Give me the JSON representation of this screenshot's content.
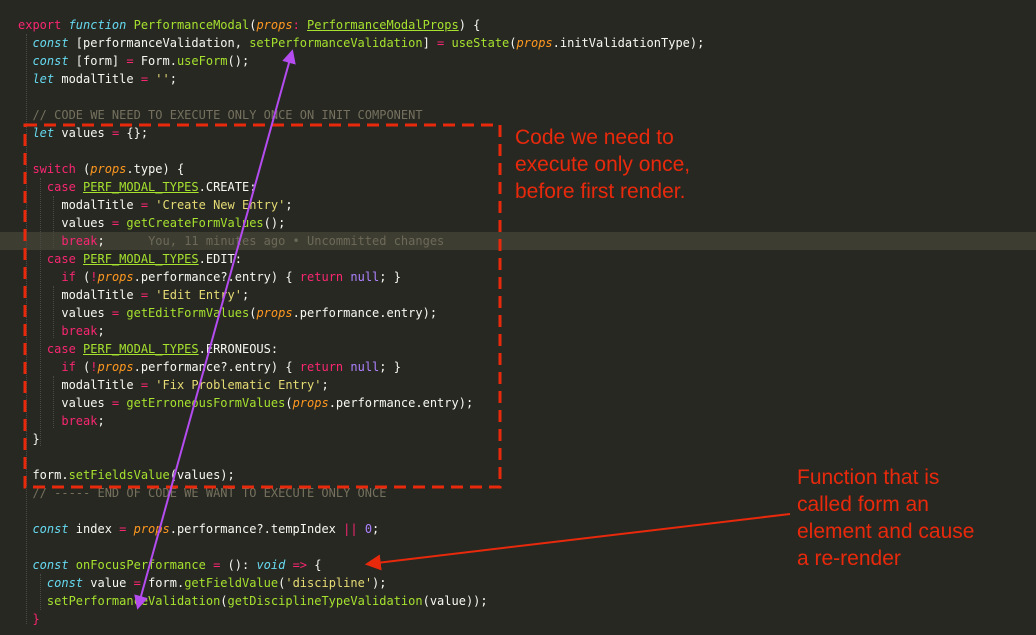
{
  "editor": {
    "lines": [
      {
        "tokens": [
          {
            "t": "export ",
            "c": "kw"
          },
          {
            "t": "function ",
            "c": "it"
          },
          {
            "t": "PerformanceModal",
            "c": "fn"
          },
          {
            "t": "(",
            "c": "bl"
          },
          {
            "t": "props",
            "c": "pr"
          },
          {
            "t": ": ",
            "c": "kw"
          },
          {
            "t": "PerformanceModalProps",
            "c": "ty"
          },
          {
            "t": ") {",
            "c": "bl"
          }
        ]
      },
      {
        "tokens": [
          {
            "t": "  const ",
            "c": "it"
          },
          {
            "t": "[performanceValidation, ",
            "c": "bl"
          },
          {
            "t": "setPerformanceValidation",
            "c": "fn"
          },
          {
            "t": "] ",
            "c": "bl"
          },
          {
            "t": "= ",
            "c": "op"
          },
          {
            "t": "useState",
            "c": "fn"
          },
          {
            "t": "(",
            "c": "bl"
          },
          {
            "t": "props",
            "c": "pr"
          },
          {
            "t": ".initValidationType);",
            "c": "bl"
          }
        ]
      },
      {
        "tokens": [
          {
            "t": "  const ",
            "c": "it"
          },
          {
            "t": "[form] ",
            "c": "bl"
          },
          {
            "t": "= ",
            "c": "op"
          },
          {
            "t": "Form.",
            "c": "bl"
          },
          {
            "t": "useForm",
            "c": "fn"
          },
          {
            "t": "();",
            "c": "bl"
          }
        ]
      },
      {
        "tokens": [
          {
            "t": "  let ",
            "c": "it"
          },
          {
            "t": "modalTitle ",
            "c": "bl"
          },
          {
            "t": "= ",
            "c": "op"
          },
          {
            "t": "''",
            "c": "st"
          },
          {
            "t": ";",
            "c": "bl"
          }
        ]
      },
      {
        "tokens": []
      },
      {
        "tokens": [
          {
            "t": "  // CODE WE NEED TO EXECUTE ONLY ONCE ON INIT COMPONENT",
            "c": "co"
          }
        ]
      },
      {
        "tokens": [
          {
            "t": "  let ",
            "c": "it"
          },
          {
            "t": "values ",
            "c": "bl"
          },
          {
            "t": "= ",
            "c": "op"
          },
          {
            "t": "{};",
            "c": "bl"
          }
        ]
      },
      {
        "tokens": []
      },
      {
        "tokens": [
          {
            "t": "  switch ",
            "c": "kw"
          },
          {
            "t": "(",
            "c": "bl"
          },
          {
            "t": "props",
            "c": "pr"
          },
          {
            "t": ".type) {",
            "c": "bl"
          }
        ]
      },
      {
        "tokens": [
          {
            "t": "    case ",
            "c": "kw"
          },
          {
            "t": "PERF_MODAL_TYPES",
            "c": "ty"
          },
          {
            "t": ".CREATE:",
            "c": "bl"
          }
        ]
      },
      {
        "tokens": [
          {
            "t": "      modalTitle ",
            "c": "bl"
          },
          {
            "t": "= ",
            "c": "op"
          },
          {
            "t": "'Create New Entry'",
            "c": "st"
          },
          {
            "t": ";",
            "c": "bl"
          }
        ]
      },
      {
        "tokens": [
          {
            "t": "      values ",
            "c": "bl"
          },
          {
            "t": "= ",
            "c": "op"
          },
          {
            "t": "getCreateFormValues",
            "c": "fn"
          },
          {
            "t": "();",
            "c": "bl"
          }
        ]
      },
      {
        "hl": true,
        "tokens": [
          {
            "t": "      break",
            "c": "kw"
          },
          {
            "t": ";",
            "c": "bl"
          },
          {
            "t": "      You, 11 minutes ago • Uncommitted changes",
            "c": "gh"
          }
        ]
      },
      {
        "tokens": [
          {
            "t": "    case ",
            "c": "kw"
          },
          {
            "t": "PERF_MODAL_TYPES",
            "c": "ty"
          },
          {
            "t": ".EDIT:",
            "c": "bl"
          }
        ]
      },
      {
        "tokens": [
          {
            "t": "      if ",
            "c": "kw"
          },
          {
            "t": "(",
            "c": "bl"
          },
          {
            "t": "!",
            "c": "op"
          },
          {
            "t": "props",
            "c": "pr"
          },
          {
            "t": ".performance?.entry) { ",
            "c": "bl"
          },
          {
            "t": "return ",
            "c": "kw"
          },
          {
            "t": "null",
            "c": "nu"
          },
          {
            "t": "; }",
            "c": "bl"
          }
        ]
      },
      {
        "tokens": [
          {
            "t": "      modalTitle ",
            "c": "bl"
          },
          {
            "t": "= ",
            "c": "op"
          },
          {
            "t": "'Edit Entry'",
            "c": "st"
          },
          {
            "t": ";",
            "c": "bl"
          }
        ]
      },
      {
        "tokens": [
          {
            "t": "      values ",
            "c": "bl"
          },
          {
            "t": "= ",
            "c": "op"
          },
          {
            "t": "getEditFormValues",
            "c": "fn"
          },
          {
            "t": "(",
            "c": "bl"
          },
          {
            "t": "props",
            "c": "pr"
          },
          {
            "t": ".performance.entry);",
            "c": "bl"
          }
        ]
      },
      {
        "tokens": [
          {
            "t": "      break",
            "c": "kw"
          },
          {
            "t": ";",
            "c": "bl"
          }
        ]
      },
      {
        "tokens": [
          {
            "t": "    case ",
            "c": "kw"
          },
          {
            "t": "PERF_MODAL_TYPES",
            "c": "ty"
          },
          {
            "t": ".ERRONEOUS:",
            "c": "bl"
          }
        ]
      },
      {
        "tokens": [
          {
            "t": "      if ",
            "c": "kw"
          },
          {
            "t": "(",
            "c": "bl"
          },
          {
            "t": "!",
            "c": "op"
          },
          {
            "t": "props",
            "c": "pr"
          },
          {
            "t": ".performance?.entry) { ",
            "c": "bl"
          },
          {
            "t": "return ",
            "c": "kw"
          },
          {
            "t": "null",
            "c": "nu"
          },
          {
            "t": "; }",
            "c": "bl"
          }
        ]
      },
      {
        "tokens": [
          {
            "t": "      modalTitle ",
            "c": "bl"
          },
          {
            "t": "= ",
            "c": "op"
          },
          {
            "t": "'Fix Problematic Entry'",
            "c": "st"
          },
          {
            "t": ";",
            "c": "bl"
          }
        ]
      },
      {
        "tokens": [
          {
            "t": "      values ",
            "c": "bl"
          },
          {
            "t": "= ",
            "c": "op"
          },
          {
            "t": "getErroneousFormValues",
            "c": "fn"
          },
          {
            "t": "(",
            "c": "bl"
          },
          {
            "t": "props",
            "c": "pr"
          },
          {
            "t": ".performance.entry);",
            "c": "bl"
          }
        ]
      },
      {
        "tokens": [
          {
            "t": "      break",
            "c": "kw"
          },
          {
            "t": ";",
            "c": "bl"
          }
        ]
      },
      {
        "tokens": [
          {
            "t": "  }",
            "c": "bl"
          }
        ]
      },
      {
        "tokens": []
      },
      {
        "tokens": [
          {
            "t": "  form.",
            "c": "bl"
          },
          {
            "t": "setFieldsValue",
            "c": "fn"
          },
          {
            "t": "(values);",
            "c": "bl"
          }
        ]
      },
      {
        "tokens": [
          {
            "t": "  // ----- END OF CODE WE WANT TO EXECUTE ONLY ONCE",
            "c": "co"
          }
        ]
      },
      {
        "tokens": []
      },
      {
        "tokens": [
          {
            "t": "  const ",
            "c": "it"
          },
          {
            "t": "index ",
            "c": "bl"
          },
          {
            "t": "= ",
            "c": "op"
          },
          {
            "t": "props",
            "c": "pr"
          },
          {
            "t": ".performance?.tempIndex ",
            "c": "bl"
          },
          {
            "t": "|| ",
            "c": "op"
          },
          {
            "t": "0",
            "c": "nu"
          },
          {
            "t": ";",
            "c": "bl"
          }
        ]
      },
      {
        "tokens": []
      },
      {
        "tokens": [
          {
            "t": "  const ",
            "c": "it"
          },
          {
            "t": "onFocusPerformance ",
            "c": "fn"
          },
          {
            "t": "= ",
            "c": "op"
          },
          {
            "t": "(): ",
            "c": "bl"
          },
          {
            "t": "void ",
            "c": "it"
          },
          {
            "t": "=> ",
            "c": "kw"
          },
          {
            "t": "{",
            "c": "bl"
          }
        ]
      },
      {
        "tokens": [
          {
            "t": "    const ",
            "c": "it"
          },
          {
            "t": "value ",
            "c": "bl"
          },
          {
            "t": "= ",
            "c": "op"
          },
          {
            "t": "form.",
            "c": "bl"
          },
          {
            "t": "getFieldValue",
            "c": "fn"
          },
          {
            "t": "(",
            "c": "bl"
          },
          {
            "t": "'discipline'",
            "c": "st"
          },
          {
            "t": ");",
            "c": "bl"
          }
        ]
      },
      {
        "tokens": [
          {
            "t": "    ",
            "c": "bl"
          },
          {
            "t": "setPerformanceValidation",
            "c": "fn"
          },
          {
            "t": "(",
            "c": "bl"
          },
          {
            "t": "getDisciplineTypeValidation",
            "c": "fn"
          },
          {
            "t": "(value));",
            "c": "bl"
          }
        ]
      },
      {
        "tokens": [
          {
            "t": "  }",
            "c": "kw"
          }
        ]
      }
    ]
  },
  "annotations": {
    "note_once": "Code we need to\nexecute only once,\nbefore first render.",
    "note_rerender": "Function that is\ncalled form an\nelement and cause\na re-render",
    "colors": {
      "red": "#E8290C",
      "purple": "#B44CF0"
    }
  },
  "theme": {
    "background": "#272822",
    "line_highlight": "#3E3D32",
    "keyword": "#F92672",
    "storage": "#66D9EF",
    "function": "#A6E22E",
    "parameter": "#FD971F",
    "string": "#E6DB74",
    "number": "#AE81FF",
    "comment": "#75715E"
  }
}
